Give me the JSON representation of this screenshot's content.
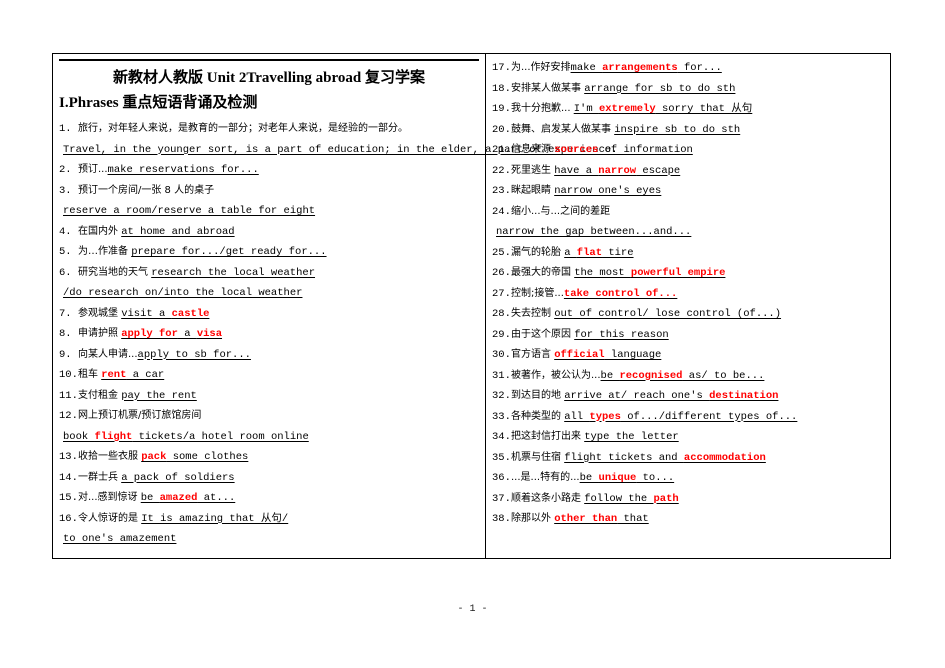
{
  "document": {
    "title": "新教材人教版 Unit  2Travelling  abroad 复习学案",
    "heading": "I.Phrases  重点短语背诵及检测",
    "page_number": "- 1 -"
  },
  "left_column": [
    {
      "num": "1.",
      "cn": "旅行，对年轻人来说，是教育的一部分；对老年人来说，是经验的一部分。",
      "en": "",
      "en_red": "",
      "en_tail": "",
      "type": "cn-only"
    },
    {
      "num": "",
      "cn": "",
      "en": "Travel, in the younger sort, is a part of education; in the elder, a part of experience.",
      "en_red": "",
      "en_tail": "",
      "type": "en-only"
    },
    {
      "num": "2.",
      "cn": "预订...",
      "en": "make reservations for...",
      "en_red": "",
      "en_tail": "",
      "type": "mixed"
    },
    {
      "num": "3.",
      "cn": "预订一个房间/一张 8 人的桌子",
      "en": "",
      "en_red": "",
      "en_tail": "",
      "type": "cn-only"
    },
    {
      "num": "",
      "cn": "",
      "en": "reserve a room/reserve a table for eight",
      "en_red": "",
      "en_tail": "",
      "type": "en-only"
    },
    {
      "num": "4.",
      "cn": "在国内外 ",
      "en": "at home and abroad",
      "en_red": "",
      "en_tail": "",
      "type": "mixed"
    },
    {
      "num": "5.",
      "cn": "为…作准备 ",
      "en": "prepare for.../get ready for...",
      "en_red": "",
      "en_tail": "",
      "type": "mixed"
    },
    {
      "num": "6.",
      "cn": "研究当地的天气 ",
      "en": "research the local weather",
      "en_red": "",
      "en_tail": "",
      "type": "mixed"
    },
    {
      "num": "",
      "cn": "",
      "en": "/do research on/into the local weather",
      "en_red": "",
      "en_tail": "",
      "type": "en-only"
    },
    {
      "num": "7.",
      "cn": "参观城堡 ",
      "en": "visit a ",
      "en_red": "castle",
      "en_tail": "",
      "type": "mixed"
    },
    {
      "num": "8.",
      "cn": "申请护照 ",
      "en": "",
      "en_red": "apply for",
      "en_tail": " a ",
      "en_red2": "visa",
      "type": "mixed-red-lead"
    },
    {
      "num": "9.",
      "cn": "向某人申请...",
      "en": "apply to sb for...",
      "en_red": "",
      "en_tail": "",
      "type": "mixed"
    },
    {
      "num": "10.",
      "cn": "租车 ",
      "en": "",
      "en_red": "rent",
      "en_tail": " a car",
      "type": "mixed-red-lead"
    },
    {
      "num": "11.",
      "cn": "支付租金 ",
      "en": "pay the rent",
      "en_red": "",
      "en_tail": "",
      "type": "mixed"
    },
    {
      "num": "12.",
      "cn": "网上预订机票/预订旅馆房间",
      "en": "",
      "en_red": "",
      "en_tail": "",
      "type": "cn-only"
    },
    {
      "num": "",
      "cn": "",
      "en": "book ",
      "en_red": "flight",
      "en_tail": " tickets/a hotel room online",
      "type": "en-only-red"
    },
    {
      "num": "13.",
      "cn": "收拾一些衣服 ",
      "en": "",
      "en_red": "pack",
      "en_tail": " some clothes",
      "type": "mixed-red-lead"
    },
    {
      "num": "14.",
      "cn": "一群士兵 ",
      "en": "a pack of soldiers",
      "en_red": "",
      "en_tail": "",
      "type": "mixed"
    },
    {
      "num": "15.",
      "cn": "对...感到惊讶 ",
      "en": "be ",
      "en_red": "amazed",
      "en_tail": " at...",
      "type": "mixed-red-mid"
    },
    {
      "num": "16.",
      "cn": "令人惊讶的是 ",
      "en": "It is amazing that 从句/",
      "en_red": "",
      "en_tail": "",
      "type": "mixed"
    },
    {
      "num": "",
      "cn": "",
      "en": "to one's amazement",
      "en_red": "",
      "en_tail": "",
      "type": "en-only"
    }
  ],
  "right_column": [
    {
      "num": "17.",
      "cn": "为...作好安排",
      "en": "make ",
      "en_red": "arrangements",
      "en_tail": " for...",
      "type": "mixed-red-mid"
    },
    {
      "num": "18.",
      "cn": "安排某人做某事 ",
      "en": "arrange for sb to do sth",
      "en_red": "",
      "en_tail": "",
      "type": "mixed"
    },
    {
      "num": "19.",
      "cn": "我十分抱歉... ",
      "en": "I'm ",
      "en_red": "extremely",
      "en_tail": " sorry that 从句",
      "type": "mixed-red-mid"
    },
    {
      "num": "20.",
      "cn": "鼓舞、启发某人做某事  ",
      "en": "inspire sb to do sth",
      "en_red": "",
      "en_tail": "",
      "type": "mixed"
    },
    {
      "num": "21.",
      "cn": "信息来源 ",
      "en": "",
      "en_red": "sources",
      "en_tail": " of information",
      "type": "mixed-red-lead"
    },
    {
      "num": "22.",
      "cn": "死里逃生 ",
      "en": "have a ",
      "en_red": "narrow",
      "en_tail": " escape",
      "type": "mixed-red-mid"
    },
    {
      "num": "23.",
      "cn": "眯起眼睛 ",
      "en": "narrow one's eyes",
      "en_red": "",
      "en_tail": "",
      "type": "mixed"
    },
    {
      "num": "24.",
      "cn": "缩小...与...之间的差距",
      "en": "",
      "en_red": "",
      "en_tail": "",
      "type": "cn-only"
    },
    {
      "num": "",
      "cn": "",
      "en": "narrow the gap between...and...",
      "en_red": "",
      "en_tail": "",
      "type": "en-only"
    },
    {
      "num": "25.",
      "cn": "漏气的轮胎 ",
      "en": "a ",
      "en_red": "flat",
      "en_tail": " tire",
      "type": "mixed-red-mid"
    },
    {
      "num": "26.",
      "cn": "最强大的帝国 ",
      "en": "the most ",
      "en_red": "powerful empire",
      "en_tail": "",
      "type": "mixed-red-mid"
    },
    {
      "num": "27.",
      "cn": "控制;接管...",
      "en": "",
      "en_red": "take control of...",
      "en_tail": "",
      "type": "mixed-red-lead"
    },
    {
      "num": "28.",
      "cn": "失去控制 ",
      "en": "out of control/ lose control (of...)",
      "en_red": "",
      "en_tail": "",
      "type": "mixed"
    },
    {
      "num": "29.",
      "cn": "由于这个原因 ",
      "en": "for this reason",
      "en_red": "",
      "en_tail": "",
      "type": "mixed"
    },
    {
      "num": "30.",
      "cn": "官方语言 ",
      "en": "",
      "en_red": "official",
      "en_tail": " language",
      "type": "mixed-red-lead"
    },
    {
      "num": "31.",
      "cn": "被著作，被公认为...",
      "en": "be ",
      "en_red": "recognised",
      "en_tail": " as/ to be...",
      "type": "mixed-red-mid"
    },
    {
      "num": "32.",
      "cn": "到达目的地 ",
      "en": "arrive at/ reach one's ",
      "en_red": "destination",
      "en_tail": "",
      "type": "mixed-red-mid"
    },
    {
      "num": "33.",
      "cn": "各种类型的 ",
      "en": "all ",
      "en_red": "types",
      "en_tail": " of.../different types of...",
      "type": "mixed-red-mid"
    },
    {
      "num": "34.",
      "cn": "把这封信打出来 ",
      "en": "type the letter",
      "en_red": "",
      "en_tail": "",
      "type": "mixed"
    },
    {
      "num": "35.",
      "cn": "机票与住宿 ",
      "en": "flight tickets and ",
      "en_red": "accommodation",
      "en_tail": "",
      "type": "mixed-red-mid"
    },
    {
      "num": "36.",
      "cn": "...是...特有的...",
      "en": "be ",
      "en_red": "unique",
      "en_tail": " to...",
      "type": "mixed-red-mid"
    },
    {
      "num": "37.",
      "cn": "顺着这条小路走 ",
      "en": "follow the ",
      "en_red": "path",
      "en_tail": "",
      "type": "mixed-red-mid"
    },
    {
      "num": "38.",
      "cn": "除那以外 ",
      "en": "",
      "en_red": "other than",
      "en_tail": " that",
      "type": "mixed-red-lead"
    }
  ],
  "colors": {
    "highlight": "#FF0000",
    "text": "#000000",
    "border": "#000000"
  }
}
